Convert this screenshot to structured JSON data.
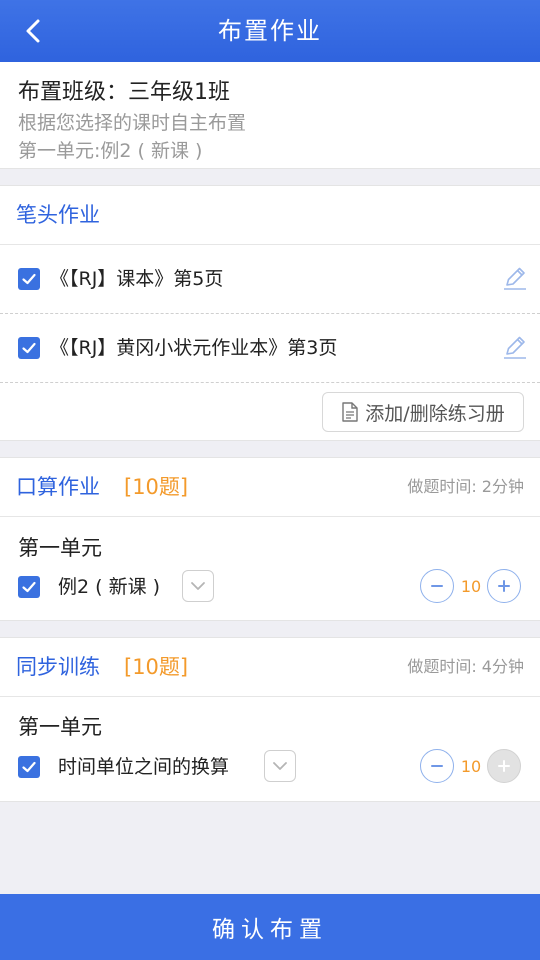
{
  "header": {
    "title": "布置作业",
    "back_icon": "chevron-left-icon"
  },
  "info": {
    "class_line": "布置班级：三年级1班",
    "hint": "根据您选择的课时自主布置",
    "lesson": "第一单元:例2 ( 新课 )"
  },
  "written": {
    "title": "笔头作业",
    "books": [
      {
        "label": "《【RJ】课本》第5页",
        "checked": true
      },
      {
        "label": "《【RJ】黄冈小状元作业本》第3页",
        "checked": true
      }
    ],
    "add_label": "添加/删除练习册"
  },
  "oral": {
    "title": "口算作业",
    "count": "[10题]",
    "time": "做题时间: 2分钟",
    "unit": "第一单元",
    "item": {
      "label": "例2 ( 新课 )",
      "qty": "10",
      "checked": true
    }
  },
  "sync": {
    "title": "同步训练",
    "count": "[10题]",
    "time": "做题时间: 4分钟",
    "unit": "第一单元",
    "item": {
      "label": "时间单位之间的换算",
      "qty": "10",
      "checked": true,
      "plus_disabled": true
    }
  },
  "footer": {
    "confirm_label": "确认布置"
  },
  "colors": {
    "primary": "#2f63de",
    "accent": "#f39a2b",
    "checkbox": "#3a71e0"
  }
}
